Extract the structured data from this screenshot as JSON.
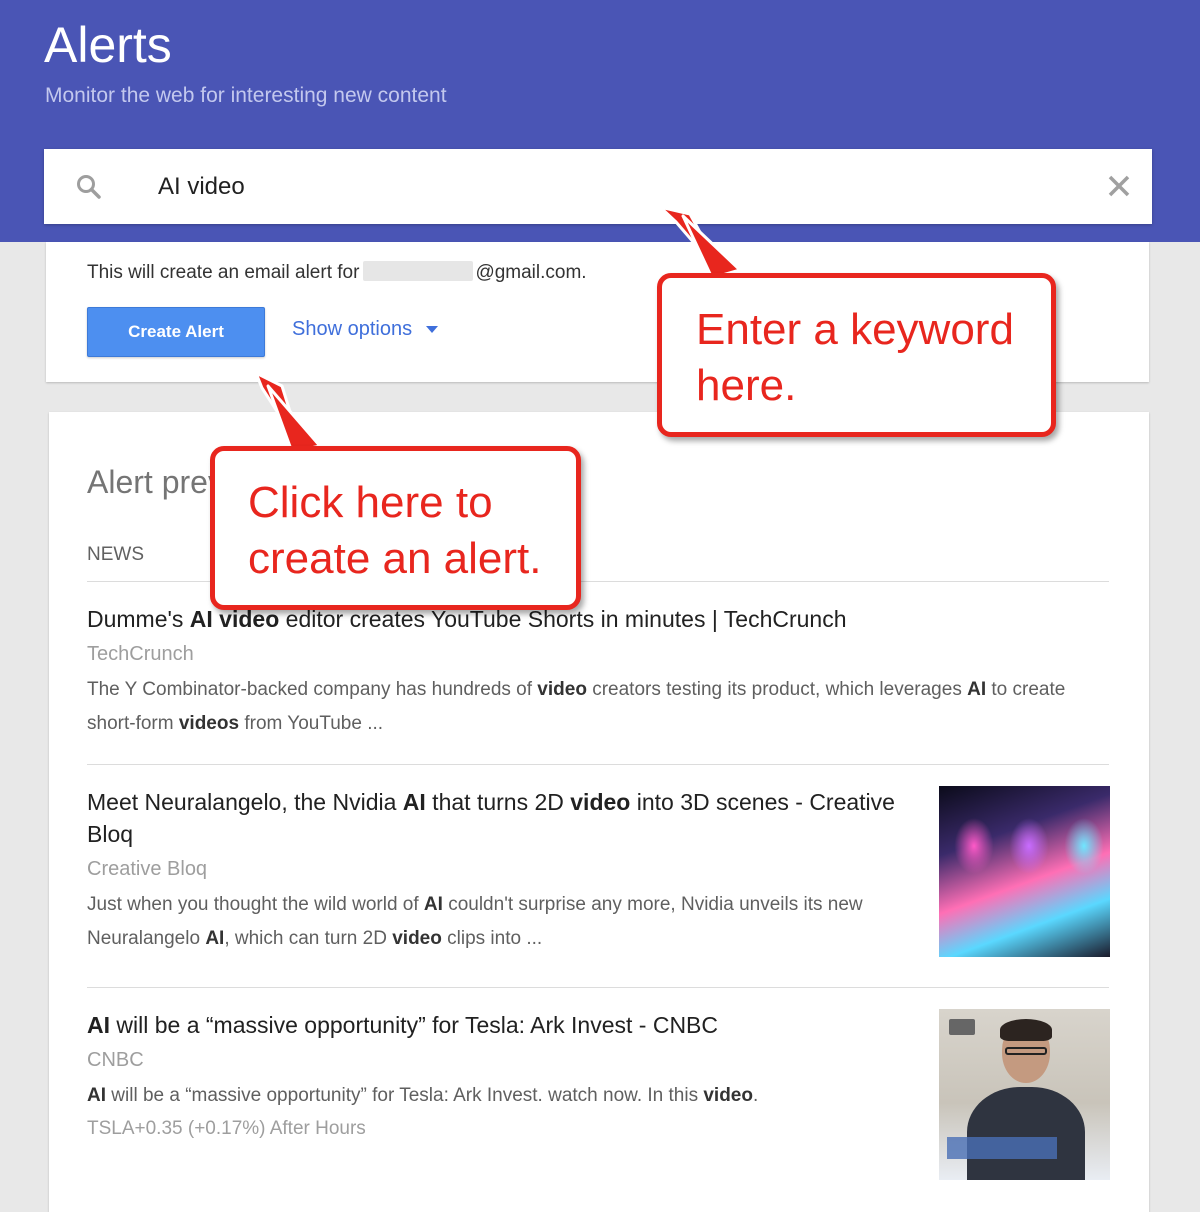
{
  "header": {
    "title": "Alerts",
    "subtitle": "Monitor the web for interesting new content"
  },
  "search": {
    "value": "AI video"
  },
  "alert_form": {
    "email_prefix": "This will create an email alert for",
    "email_domain": "@gmail.com.",
    "create_label": "Create Alert",
    "options_label": "Show options"
  },
  "preview": {
    "title": "Alert preview",
    "section_label": "NEWS",
    "items": [
      {
        "headline": "Dumme's AI video editor creates YouTube Shorts in minutes | TechCrunch",
        "source": "TechCrunch",
        "snippet": "The Y Combinator-backed company has hundreds of video creators testing its product, which leverages AI to create short-form videos from YouTube ..."
      },
      {
        "headline": "Meet Neuralangelo, the Nvidia AI that turns 2D video into 3D scenes - Creative Bloq",
        "source": "Creative Bloq",
        "snippet": "Just when you thought the wild world of AI couldn't surprise any more, Nvidia unveils its new Neuralangelo AI, which can turn 2D video clips into ..."
      },
      {
        "headline": "AI will be a “massive opportunity” for Tesla: Ark Invest - CNBC",
        "source": "CNBC",
        "snippet": "AI will be a “massive opportunity” for Tesla: Ark Invest. watch now. In this video.",
        "ticker": "TSLA+0.35 (+0.17%) After Hours"
      }
    ]
  },
  "callouts": {
    "keyword": "Enter a keyword here.",
    "create": "Click here to create an alert."
  },
  "colors": {
    "header_bg": "#4a55b5",
    "button_blue": "#4d8ff0",
    "link_blue": "#3f6fdb",
    "callout_red": "#e8261e"
  },
  "icons": [
    "search-icon",
    "close-icon",
    "caret-down-icon"
  ]
}
